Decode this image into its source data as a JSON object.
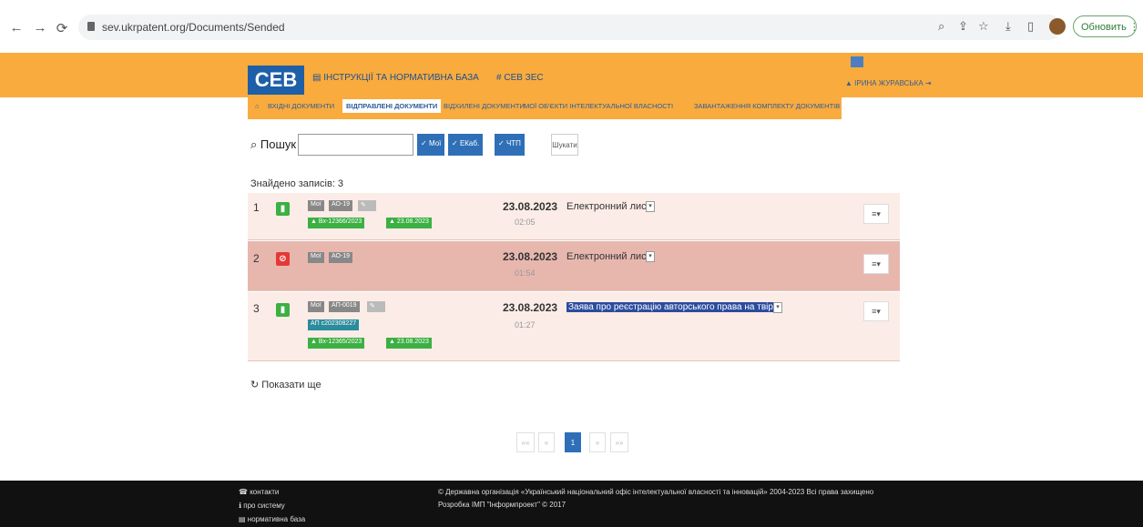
{
  "browser": {
    "url": "sev.ukrpatent.org/Documents/Sended",
    "update_label": "Обновить"
  },
  "header": {
    "logo": "СЕВ",
    "links": [
      "ІНСТРУКЦІЇ ТА НОРМАТИВНА БАЗА",
      "СЕВ ЗЕС"
    ],
    "user": "ІРИНА ЖУРАВСЬКА"
  },
  "tabs": [
    {
      "label": "ВХІДНІ ДОКУМЕНТИ",
      "active": false
    },
    {
      "label": "ВІДПРАВЛЕНІ ДОКУМЕНТИ",
      "active": true
    },
    {
      "label": "ВІДХИЛЕНІ ДОКУМЕНТИ",
      "active": false
    },
    {
      "label": "МОЇ ОБ'ЄКТИ ІНТЕЛЕКТУАЛЬНОЇ ВЛАСНОСТІ",
      "active": false
    },
    {
      "label": "ЗАВАНТАЖЕННЯ КОМПЛЕКТУ ДОКУМЕНТІВ",
      "active": false
    }
  ],
  "search": {
    "label": "Пошук",
    "value": "",
    "filters": [
      "Мої",
      "ЕКаб.",
      "ЧТП"
    ],
    "cancel": "Шукати"
  },
  "found": "Знайдено записів: 3",
  "records": [
    {
      "num": "1",
      "status": "ok",
      "badges": [
        "Мої",
        "АО-19"
      ],
      "tags": [
        "Вх-12366/2023",
        "23.08.2023"
      ],
      "extra": "",
      "date": "23.08.2023",
      "time": "02:05",
      "title": "Електронний лист",
      "highlight": false
    },
    {
      "num": "2",
      "status": "error",
      "badges": [
        "Мої",
        "АО-19"
      ],
      "tags": [],
      "extra": "",
      "date": "23.08.2023",
      "time": "01:54",
      "title": "Електронний лист",
      "highlight": false
    },
    {
      "num": "3",
      "status": "ok",
      "badges": [
        "Мої",
        "АП-0019"
      ],
      "tags": [
        "Вх-12365/2023",
        "23.08.2023"
      ],
      "extra": "АП  c202308227",
      "date": "23.08.2023",
      "time": "01:27",
      "title": "Заява про реєстрацію авторського права на твір",
      "highlight": true
    }
  ],
  "show_all": "Показати ще",
  "pagination": {
    "first": "««",
    "prev": "«",
    "current": "1",
    "next": "»",
    "last": "»»"
  },
  "footer": {
    "links": [
      "контакти",
      "про систему",
      "нормативна база"
    ],
    "copyright": "© Державна організація «Український національний офіс інтелектуальної власності та інновацій» 2004-2023 Всі права захищено",
    "dev": "Розробка ІМП \"Інформпроект\" © 2017"
  },
  "colors": {
    "accent": "#f9ab3e",
    "primary": "#2f6fb7",
    "ok": "#3cb043",
    "error": "#e53935",
    "row_highlight": "#e7b7ae"
  }
}
